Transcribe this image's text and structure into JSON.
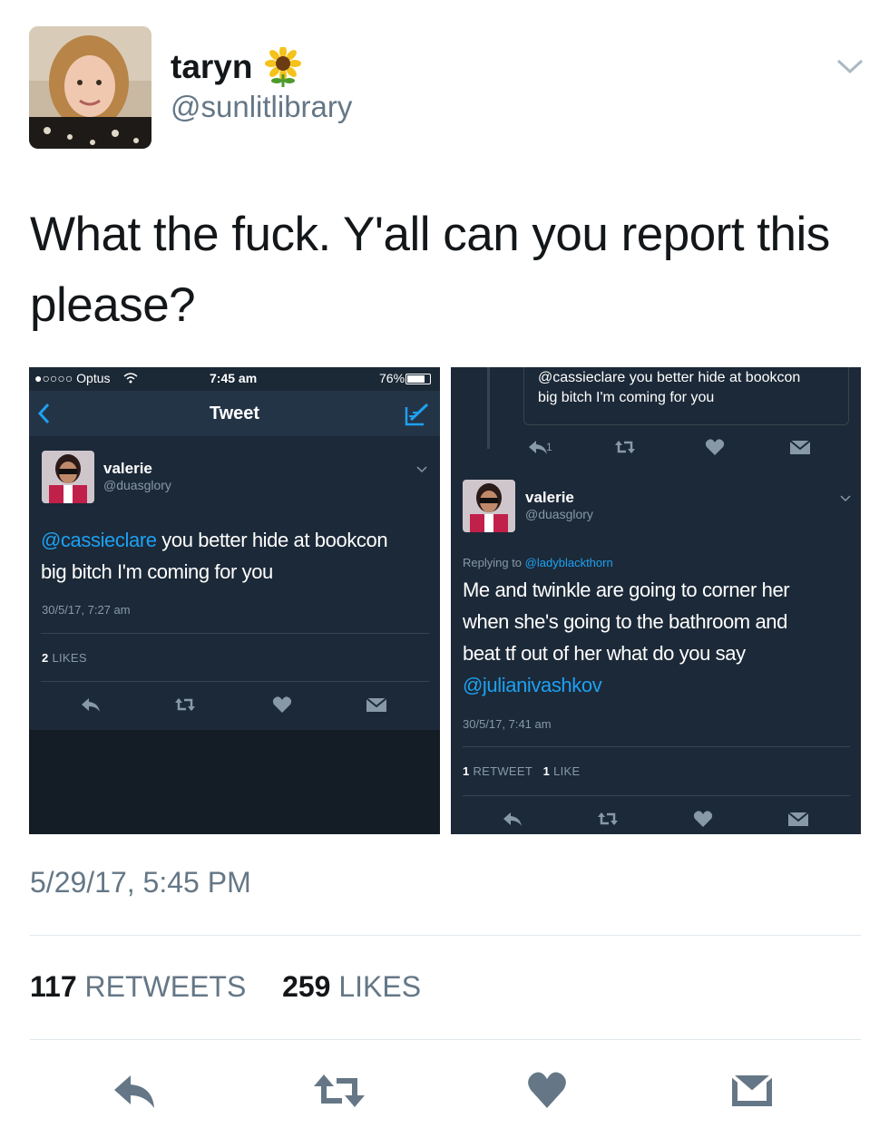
{
  "tweet": {
    "author_name": "taryn",
    "author_handle": "@sunlitlibrary",
    "text": "What the fuck. Y'all can you report this please?",
    "timestamp": "5/29/17, 5:45 PM",
    "retweet_count": "117",
    "retweet_label": "RETWEETS",
    "like_count": "259",
    "like_label": "LIKES"
  },
  "screenshot_left": {
    "carrier": "●○○○○ Optus",
    "time": "7:45 am",
    "battery": "76%",
    "nav_title": "Tweet",
    "author_name": "valerie",
    "author_handle": "@duasglory",
    "mention": "@cassieclare",
    "text_line1_rest": " you better hide at bookcon",
    "text_line2": "big bitch I'm coming for you",
    "date": "30/5/17, 7:27 am",
    "likes_count": "2",
    "likes_label": "LIKES"
  },
  "screenshot_right": {
    "quoted_text_line1": "@cassieclare you better hide at bookcon",
    "quoted_text_line2": "big bitch I'm coming for you",
    "quoted_reply_count": "1",
    "author_name": "valerie",
    "author_handle": "@duasglory",
    "replying_label": "Replying to",
    "replying_to": "@ladyblackthorn",
    "text_line1": "Me and twinkle are going to corner her",
    "text_line2": "when she's going to the bathroom and",
    "text_line3": "beat tf out of her what do you say",
    "text_mention": "@julianivashkov",
    "date": "30/5/17, 7:41 am",
    "retweet_count": "1",
    "retweet_label": "RETWEET",
    "like_count": "1",
    "like_label": "LIKE"
  },
  "colors": {
    "link_blue": "#1da1f2",
    "dark_bg": "#1c2938",
    "muted": "#657786"
  },
  "icons": [
    "sunflower-emoji",
    "chevron-down-icon",
    "reply-icon",
    "retweet-icon",
    "heart-icon",
    "dm-icon",
    "back-arrow-icon",
    "compose-icon",
    "wifi-icon"
  ]
}
